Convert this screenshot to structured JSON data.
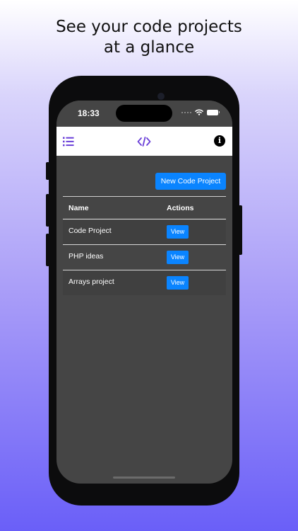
{
  "headline": {
    "line1": "See your code projects",
    "line2": "at a glance"
  },
  "status_bar": {
    "time": "18:33",
    "icons": [
      "signal-icon",
      "wifi-icon",
      "battery-icon"
    ]
  },
  "navbar": {
    "menu_icon": "list-menu-icon",
    "logo_icon": "code-brackets-icon",
    "info_label": "i",
    "accent_color": "#6a3fd8"
  },
  "main": {
    "new_project_label": "New Code Project",
    "table": {
      "headers": {
        "name": "Name",
        "actions": "Actions"
      },
      "rows": [
        {
          "name": "Code Project",
          "action": "View"
        },
        {
          "name": "PHP ideas",
          "action": "View"
        },
        {
          "name": "Arrays project",
          "action": "View"
        }
      ]
    }
  },
  "colors": {
    "primary_button": "#0a84ff",
    "screen_background": "#454545"
  }
}
